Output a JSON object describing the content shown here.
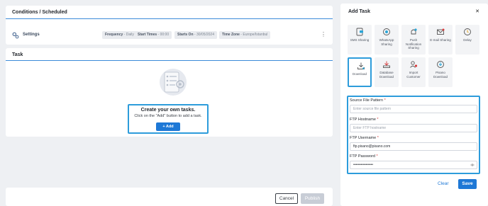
{
  "conditions": {
    "title": "Conditions / Scheduled",
    "settings_label": "Settings",
    "pills": [
      {
        "key": "Frequency",
        "value": "Daily"
      },
      {
        "key": "Start Times",
        "value": "00:00"
      },
      {
        "key": "Starts On",
        "value": "30/05/2024"
      },
      {
        "key": "Time Zone",
        "value": "Europe/Istanbul"
      }
    ],
    "pill_sep": " - "
  },
  "task": {
    "title": "Task",
    "empty_title": "Create your own tasks.",
    "empty_sub": "Click on the \"Add\" button to add a task.",
    "add_label": "+ Add"
  },
  "footer": {
    "cancel_label": "Cancel",
    "publish_label": "Publish"
  },
  "side": {
    "title": "Add Task",
    "close": "✕",
    "tiles": [
      {
        "label": "SMS Sharing",
        "icon": "sms-icon"
      },
      {
        "label": "WhatsApp Sharing",
        "icon": "whatsapp-icon"
      },
      {
        "label": "Push Notification Sharing",
        "icon": "push-notification-icon"
      },
      {
        "label": "E-mail Sharing",
        "icon": "email-icon"
      },
      {
        "label": "Delay",
        "icon": "clock-icon"
      },
      {
        "label": "Download",
        "icon": "download-icon",
        "selected": true
      },
      {
        "label": "Database Download",
        "icon": "database-download-icon"
      },
      {
        "label": "Import Customer",
        "icon": "import-customer-icon"
      },
      {
        "label": "Pisano Download",
        "icon": "pisano-download-icon"
      }
    ],
    "form": {
      "source_label": "Source File Pattern",
      "source_placeholder": "Enter source file pattern",
      "host_label": "FTP Hostname",
      "host_placeholder": "Enter FTP hostname",
      "user_label": "FTP Username",
      "user_value": "ftp.pisano@pisano.com",
      "pass_label": "FTP Password",
      "pass_value": "••••••••••••••••",
      "required_mark": "*"
    },
    "clear_label": "Clear",
    "save_label": "Save"
  },
  "colors": {
    "accent": "#1e78d6",
    "highlight": "#2d9cdb",
    "required": "#d83a3a"
  }
}
